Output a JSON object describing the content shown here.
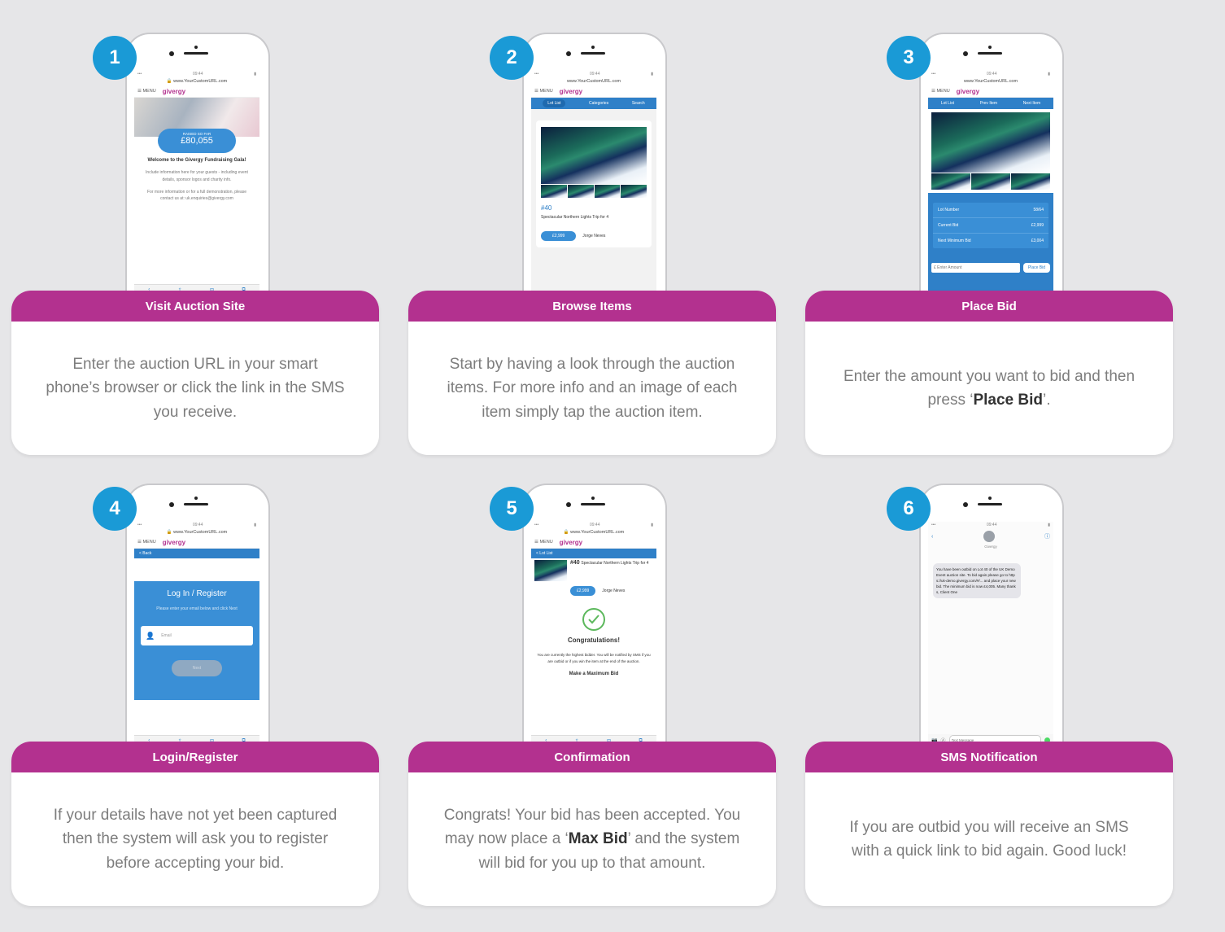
{
  "colors": {
    "accent": "#b3318f",
    "badge": "#1a9ad6",
    "background": "#e6e6e8",
    "app_blue": "#2f80c8"
  },
  "steps": [
    {
      "number": "1",
      "title": "Visit Auction Site",
      "desc": "Enter the auction URL in your smart phone’s browser or click the link in the SMS you receive.",
      "phone": {
        "url": "www.YourCustomURL.com",
        "menu": "MENU",
        "logo": "givergy",
        "raised_label": "RAISED SO FAR",
        "raised_amount": "£80,055",
        "welcome": "Welcome to the Givergy Fundraising Gala!",
        "info": "Include information here for your guests - including event details, sponsor logos and charity info.",
        "contact": "For more information or for a full demonstration, please contact us at: uk.enquiries@givergy.com"
      }
    },
    {
      "number": "2",
      "title": "Browse Items",
      "desc": "Start by having a look through the auction items. For more info and an image of each item simply tap the auction item.",
      "phone": {
        "url": "www.YourCustomURL.com",
        "menu": "MENU",
        "logo": "givergy",
        "tabs": [
          "Lot List",
          "Categories",
          "Search"
        ],
        "lot": "#40",
        "item": "Spectacular Northern Lights Trip for 4",
        "price": "£2,999",
        "bidder": "Jorge Neves"
      }
    },
    {
      "number": "3",
      "title": "Place Bid",
      "desc_pre": "Enter the amount you want to bid and then press ‘",
      "desc_bold": "Place Bid",
      "desc_post": "’.",
      "phone": {
        "url": "www.YourCustomURL.com",
        "menu": "MENU",
        "logo": "givergy",
        "tabs": [
          "Lot List",
          "Prev Item",
          "Next Item"
        ],
        "rows": [
          [
            "Lot Number",
            "58/64"
          ],
          [
            "Current Bid",
            "£2,999"
          ],
          [
            "Next Minimum Bid",
            "£3,004"
          ]
        ],
        "placeholder": "£ Enter Amount",
        "button": "Place Bid"
      }
    },
    {
      "number": "4",
      "title": "Login/Register",
      "desc": "If your details have not yet been captured then the system will ask you to register before accepting your bid.",
      "phone": {
        "url": "www.YourCustomURL.com",
        "menu": "MENU",
        "logo": "givergy",
        "back": "< Back",
        "heading": "Log In / Register",
        "instructions": "Please enter your email below and click Next",
        "field": "Email",
        "button": "Next"
      }
    },
    {
      "number": "5",
      "title": "Confirmation",
      "desc_pre": "Congrats! Your bid has been accepted. You may now place a ‘",
      "desc_bold": "Max Bid",
      "desc_post": "’ and the system will bid for you up to that amount.",
      "phone": {
        "url": "www.YourCustomURL.com",
        "menu": "MENU",
        "logo": "givergy",
        "back": "< Lot List",
        "lot": "#40",
        "item": "Spectacular Northern Lights Trip for 4",
        "price": "£2,999",
        "bidder": "Jorge Neves",
        "congrats": "Congratulations!",
        "message": "You are currently the highest bidder. You will be notified by SMS if you are outbid or if you win the item at the end of the auction.",
        "max": "Make a Maximum Bid"
      }
    },
    {
      "number": "6",
      "title": "SMS Notification",
      "desc": "If you are outbid you will receive an SMS with a quick link to bid again. Good luck!",
      "phone": {
        "sender": "Givergy",
        "sms": "You have been outbid on Lot 40 of the UK Demo Event auction site. To bid again please go to https://uk-demo.givergy.com/#/... and place your new bid. The minimum bid is now £4,005. Many thanks, Client One",
        "input_placeholder": "Text Message"
      }
    }
  ]
}
